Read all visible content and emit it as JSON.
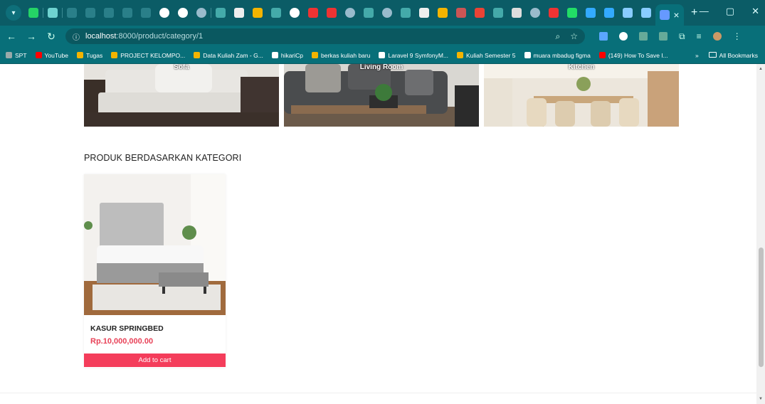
{
  "browser": {
    "url_host": "localhost",
    "url_path": ":8000/product/category/1",
    "bookmarks": [
      {
        "label": "SPT",
        "color": "#9aa"
      },
      {
        "label": "YouTube",
        "color": "#f00"
      },
      {
        "label": "Tugas",
        "color": "#f4b400"
      },
      {
        "label": "PROJECT KELOMPO...",
        "color": "#f4b400"
      },
      {
        "label": "Data Kuliah Zam - G...",
        "color": "#f4b400"
      },
      {
        "label": "hikariCp",
        "color": "#fff"
      },
      {
        "label": "berkas kuliah baru",
        "color": "#f4b400"
      },
      {
        "label": "Laravel 9 SymfonyM...",
        "color": "#fff"
      },
      {
        "label": "Kuliah Semester 5",
        "color": "#f4b400"
      },
      {
        "label": "muara mbadug figma",
        "color": "#fff"
      },
      {
        "label": "(149) How To Save I...",
        "color": "#f00"
      }
    ],
    "more_label": "»",
    "all_bookmarks_label": "All Bookmarks"
  },
  "categories": [
    {
      "label": "Sofa"
    },
    {
      "label": "Living Room"
    },
    {
      "label": "Kitchen"
    }
  ],
  "section": {
    "title": "PRODUK BERDASARKAN KATEGORI"
  },
  "products": [
    {
      "name": "KASUR SPRINGBED",
      "price": "Rp.10,000,000.00",
      "button_label": "Add to cart"
    }
  ],
  "colors": {
    "chrome": "#086f79",
    "accent": "#f43d5b",
    "price": "#e84157"
  }
}
